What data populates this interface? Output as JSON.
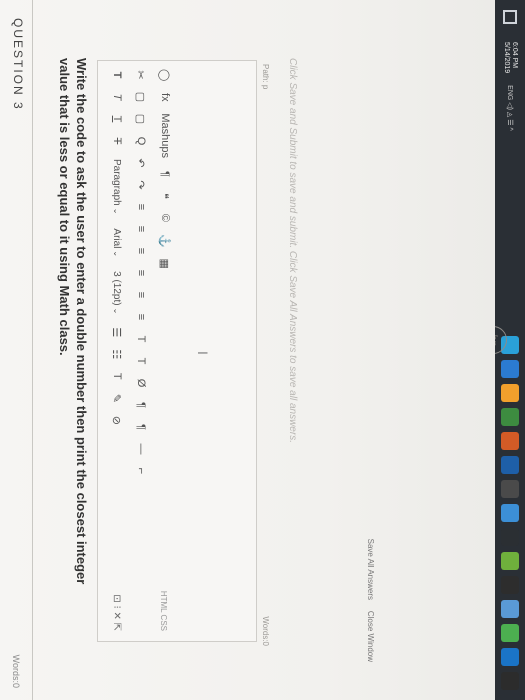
{
  "question": {
    "header": "QUESTION 3",
    "points": "Words:0",
    "text": "Write the code to ask the user to enter a double number then print the closest integer value that is less or equal to it using Math class."
  },
  "editor": {
    "style_buttons": [
      "T",
      "T",
      "T",
      "T"
    ],
    "paragraph_dropdown": "Paragraph",
    "font_dropdown": "Arial",
    "size_dropdown": "3 (12pt)",
    "row2_buttons": [
      "✂",
      "▢",
      "▢",
      "Q",
      "↶",
      "↷",
      "≡",
      "≡",
      "≡",
      "≡",
      "≡",
      "≡",
      "T",
      "T",
      "Ø",
      "¶",
      "¶",
      "—",
      "⌐"
    ],
    "row3_buttons": [
      "◯",
      "fx",
      "Mashups",
      "¶",
      "❝",
      "©",
      "⚓",
      "▦"
    ],
    "right_tools": "⊡ ⁝ ✕ ⇱",
    "html_css": "HTML CSS",
    "path_label": "Path: p",
    "words_label": "Words:0"
  },
  "footer": {
    "submit_note": "Click Save and Submit to save and submit. Click Save All Answers to save all answers.",
    "save_all": "Save All Answers",
    "close_window": "Close Window"
  },
  "taskbar": {
    "time": "6:04 PM",
    "date": "5/14/2019",
    "tray": "ENG ◁) ◬ ☰ ^",
    "icon_colors": [
      "#2aa1d8",
      "#2b7bd1",
      "#f2a02c",
      "#3d8c40",
      "#d35b26",
      "#1e5fa8",
      "#4a4a4a",
      "#3c8fd6",
      "#2b2f33",
      "#6fb03c",
      "#2d2d2d",
      "#5a9ad6",
      "#4caf50",
      "#1a74c7",
      "#2c2c2c"
    ]
  }
}
